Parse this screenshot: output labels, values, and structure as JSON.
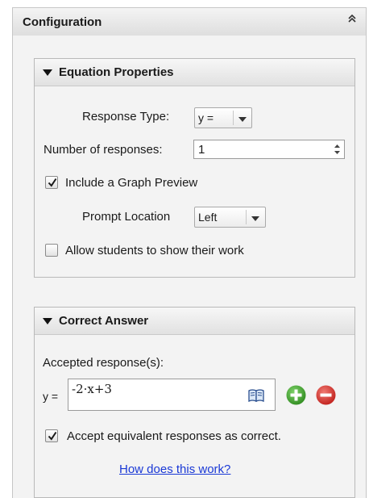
{
  "panel": {
    "title": "Configuration",
    "collapse_icon": "double-chevron-up-icon"
  },
  "equation_properties": {
    "title": "Equation Properties",
    "response_type_label": "Response Type:",
    "response_type_value": "y =",
    "num_responses_label": "Number of responses:",
    "num_responses_value": "1",
    "graph_preview_label": "Include a Graph Preview",
    "graph_preview_checked": true,
    "prompt_location_label": "Prompt Location",
    "prompt_location_value": "Left",
    "show_work_label": "Allow students to show their work",
    "show_work_checked": false
  },
  "correct_answer": {
    "title": "Correct Answer",
    "accepted_label": "Accepted response(s):",
    "prefix": "y =",
    "response_value": "-2·x+3",
    "book_icon": "math-template-book-icon",
    "add_icon": "add-green-circle-icon",
    "remove_icon": "remove-red-circle-icon",
    "equivalent_label": "Accept equivalent responses as correct.",
    "equivalent_checked": true,
    "help_link": "How does this work?"
  },
  "colors": {
    "add_button": "#3fa52b",
    "remove_button": "#d9302d",
    "link": "#1a39d6"
  }
}
